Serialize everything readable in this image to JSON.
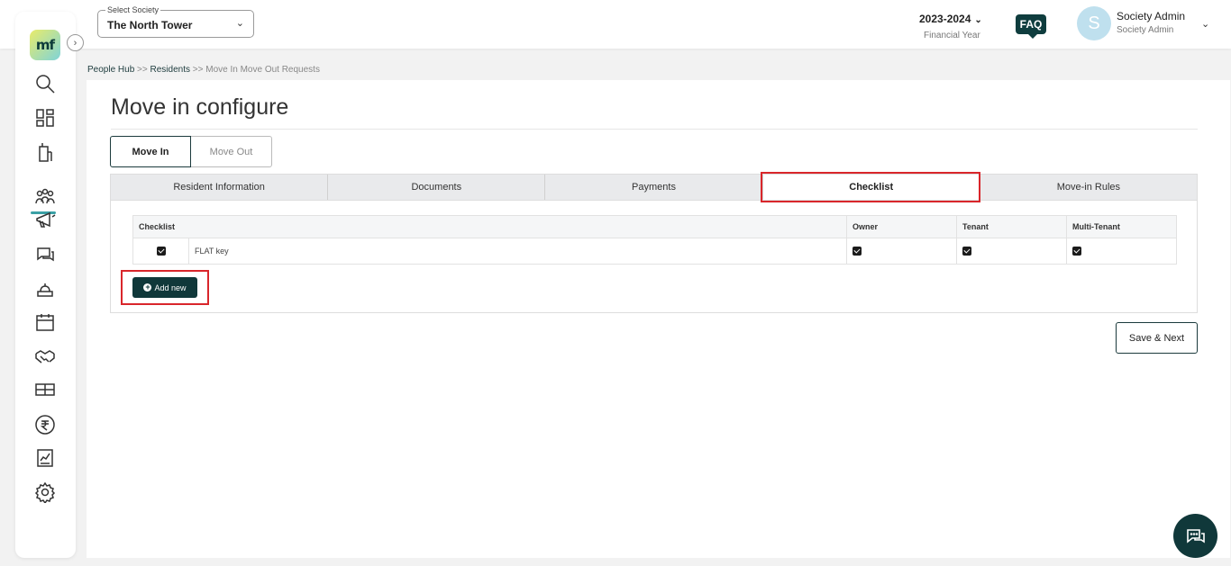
{
  "sidebar": {
    "logo_text": "mf",
    "icons": [
      "search-icon",
      "dashboard-icon",
      "building-icon",
      "people-icon",
      "megaphone-icon",
      "chat-icon",
      "service-icon",
      "calendar-icon",
      "handshake-icon",
      "parking-icon",
      "rupee-icon",
      "report-icon",
      "gear-icon"
    ]
  },
  "header": {
    "society_legend": "Select Society",
    "society_value": "The North Tower",
    "financial_year": "2023-2024",
    "financial_year_label": "Financial Year",
    "faq_label": "FAQ",
    "avatar_initial": "S",
    "user_name": "Society Admin",
    "user_role": "Society Admin"
  },
  "breadcrumb": {
    "items": [
      "People Hub",
      "Residents",
      "Move In Move Out Requests"
    ],
    "separator": ">>"
  },
  "main": {
    "title": "Move in configure",
    "segments": [
      "Move In",
      "Move Out"
    ],
    "active_segment": "Move In",
    "tabs": [
      "Resident Information",
      "Documents",
      "Payments",
      "Checklist",
      "Move-in Rules"
    ],
    "active_tab": "Checklist",
    "table": {
      "headers": [
        "Checklist",
        "Owner",
        "Tenant",
        "Multi-Tenant"
      ],
      "rows": [
        {
          "checked": true,
          "label": "FLAT key",
          "owner": true,
          "tenant": true,
          "multi_tenant": true
        }
      ]
    },
    "add_new_label": "Add new",
    "save_next_label": "Save & Next"
  },
  "colors": {
    "accent": "#10383a",
    "highlight": "#d9262b",
    "avatar": "#bfe0ee"
  }
}
